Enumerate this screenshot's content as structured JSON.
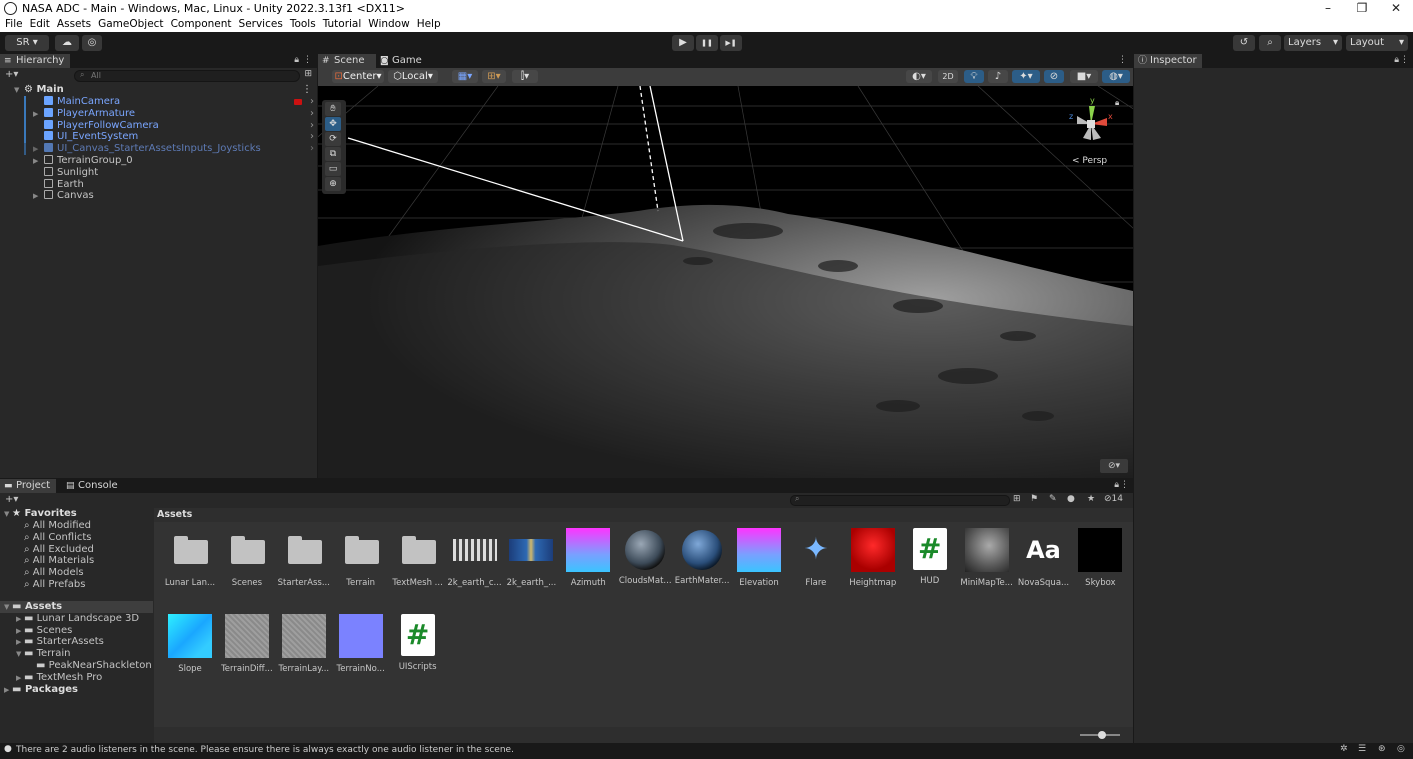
{
  "window": {
    "title": "NASA ADC - Main - Windows, Mac, Linux - Unity 2022.3.13f1 <DX11>",
    "controls": [
      "–",
      "❐",
      "✕"
    ]
  },
  "menu": [
    "File",
    "Edit",
    "Assets",
    "GameObject",
    "Component",
    "Services",
    "Tools",
    "Tutorial",
    "Window",
    "Help"
  ],
  "toolbar": {
    "account": "SR ▾",
    "cloud_icon": "cloud-icon",
    "collab_icon": "collab-icon",
    "play": "▶",
    "pause": "❚❚",
    "step": "▶❚",
    "history_icon": "history-icon",
    "search_icon": "search-icon",
    "layers": "Layers",
    "layout": "Layout"
  },
  "hierarchy": {
    "tab": "Hierarchy",
    "add": "+▾",
    "search_placeholder": "All",
    "scene": "Main",
    "items": [
      {
        "label": "MainCamera",
        "highlight": true,
        "expand": ""
      },
      {
        "label": "PlayerArmature",
        "highlight": true,
        "expand": "▶"
      },
      {
        "label": "PlayerFollowCamera",
        "highlight": true,
        "expand": ""
      },
      {
        "label": "UI_EventSystem",
        "highlight": true,
        "expand": ""
      },
      {
        "label": "UI_Canvas_StarterAssetsInputs_Joysticks",
        "highlight": true,
        "expand": "▶",
        "dim": true
      },
      {
        "label": "TerrainGroup_0",
        "highlight": false,
        "expand": "▶"
      },
      {
        "label": "Sunlight",
        "highlight": false,
        "expand": ""
      },
      {
        "label": "Earth",
        "highlight": false,
        "expand": ""
      },
      {
        "label": "Canvas",
        "highlight": false,
        "expand": "▶"
      }
    ]
  },
  "scene": {
    "tabs": [
      "Scene",
      "Game"
    ],
    "pivot": "Center",
    "space": "Local",
    "mode_2d": "2D",
    "persp": "< Persp",
    "gizmo_axes": {
      "x": "x",
      "y": "y",
      "z": "z"
    }
  },
  "inspector": {
    "tab": "Inspector"
  },
  "project": {
    "tabs": [
      "Project",
      "Console"
    ],
    "add": "+▾",
    "count": "14",
    "favorites": {
      "label": "Favorites",
      "items": [
        "All Modified",
        "All Conflicts",
        "All Excluded",
        "All Materials",
        "All Models",
        "All Prefabs"
      ]
    },
    "tree": [
      {
        "label": "Assets",
        "level": 0,
        "bold": true,
        "open": true
      },
      {
        "label": "Lunar Landscape 3D",
        "level": 1
      },
      {
        "label": "Scenes",
        "level": 1
      },
      {
        "label": "StarterAssets",
        "level": 1
      },
      {
        "label": "Terrain",
        "level": 1,
        "open": true
      },
      {
        "label": "PeakNearShackleton",
        "level": 2
      },
      {
        "label": "TextMesh Pro",
        "level": 1
      },
      {
        "label": "Packages",
        "level": 0,
        "bold": true
      }
    ],
    "breadcrumb": "Assets",
    "assets": [
      {
        "label": "Lunar Lan...",
        "kind": "folder"
      },
      {
        "label": "Scenes",
        "kind": "folder"
      },
      {
        "label": "StarterAss...",
        "kind": "folder"
      },
      {
        "label": "Terrain",
        "kind": "folder"
      },
      {
        "label": "TextMesh ...",
        "kind": "folder"
      },
      {
        "label": "2k_earth_c...",
        "kind": "clouds"
      },
      {
        "label": "2k_earth_...",
        "kind": "earthmap"
      },
      {
        "label": "Azimuth",
        "kind": "gradient"
      },
      {
        "label": "CloudsMat...",
        "kind": "sphere"
      },
      {
        "label": "EarthMater...",
        "kind": "sphere2"
      },
      {
        "label": "Elevation",
        "kind": "gradient"
      },
      {
        "label": "Flare",
        "kind": "flare"
      },
      {
        "label": "Heightmap",
        "kind": "red"
      },
      {
        "label": "HUD",
        "kind": "script"
      },
      {
        "label": "MiniMapTe...",
        "kind": "moon"
      },
      {
        "label": "NovaSqua...",
        "kind": "font"
      },
      {
        "label": "Skybox",
        "kind": "black"
      },
      {
        "label": "Slope",
        "kind": "cyan"
      },
      {
        "label": "TerrainDiff...",
        "kind": "gray"
      },
      {
        "label": "TerrainLay...",
        "kind": "gray"
      },
      {
        "label": "TerrainNo...",
        "kind": "normal"
      },
      {
        "label": "UIScripts",
        "kind": "script"
      }
    ],
    "font_glyph": "Aa",
    "script_glyph": "#"
  },
  "status": {
    "message": "There are 2 audio listeners in the scene. Please ensure there is always exactly one audio listener in the scene."
  },
  "colors": {
    "accent": "#2c5d87",
    "highlight_bar": "#3a79bb",
    "bg": "#282828"
  }
}
